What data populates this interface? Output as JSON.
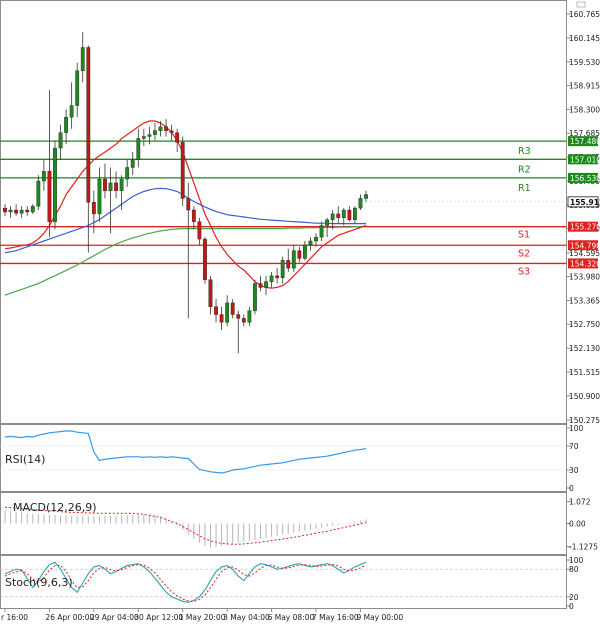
{
  "chart_data": {
    "type": "candlestick",
    "instrument_panel": {
      "price_ticks": [
        "160.765",
        "160.145",
        "159.530",
        "158.915",
        "158.300",
        "157.685",
        "157.065",
        "156.450",
        "155.835",
        "155.220",
        "154.595",
        "153.980",
        "153.365",
        "152.750",
        "152.130",
        "151.515",
        "150.900",
        "150.275"
      ],
      "ylim": [
        150.0,
        161.0
      ],
      "last_price": "155.912",
      "levels": [
        {
          "name": "R3",
          "value": 157.48,
          "label": "157.480",
          "color": "#1b8a1b"
        },
        {
          "name": "R2",
          "value": 157.01,
          "label": "157.010",
          "color": "#1b8a1b"
        },
        {
          "name": "R1",
          "value": 156.53,
          "label": "156.530",
          "color": "#1b8a1b"
        },
        {
          "name": "S1",
          "value": 155.27,
          "label": "155.270",
          "color": "#e02020"
        },
        {
          "name": "S2",
          "value": 154.79,
          "label": "154.790",
          "color": "#e02020"
        },
        {
          "name": "S3",
          "value": 154.32,
          "label": "154.320",
          "color": "#e02020"
        }
      ],
      "candles": [
        {
          "o": 155.75,
          "h": 155.85,
          "l": 155.55,
          "c": 155.65
        },
        {
          "o": 155.65,
          "h": 155.8,
          "l": 155.5,
          "c": 155.7
        },
        {
          "o": 155.7,
          "h": 155.85,
          "l": 155.55,
          "c": 155.62
        },
        {
          "o": 155.62,
          "h": 155.8,
          "l": 155.5,
          "c": 155.7
        },
        {
          "o": 155.7,
          "h": 155.8,
          "l": 155.55,
          "c": 155.65
        },
        {
          "o": 155.65,
          "h": 155.85,
          "l": 155.6,
          "c": 155.8
        },
        {
          "o": 155.8,
          "h": 156.6,
          "l": 155.7,
          "c": 156.45
        },
        {
          "o": 156.45,
          "h": 157.0,
          "l": 156.2,
          "c": 156.7
        },
        {
          "o": 156.7,
          "h": 158.8,
          "l": 155.0,
          "c": 155.4
        },
        {
          "o": 155.4,
          "h": 157.5,
          "l": 155.2,
          "c": 157.3
        },
        {
          "o": 157.3,
          "h": 157.9,
          "l": 157.0,
          "c": 157.7
        },
        {
          "o": 157.7,
          "h": 158.3,
          "l": 157.4,
          "c": 158.1
        },
        {
          "o": 158.1,
          "h": 159.0,
          "l": 157.8,
          "c": 158.4
        },
        {
          "o": 158.4,
          "h": 159.5,
          "l": 158.1,
          "c": 159.3
        },
        {
          "o": 159.3,
          "h": 160.3,
          "l": 159.0,
          "c": 159.9
        },
        {
          "o": 159.9,
          "h": 159.95,
          "l": 154.6,
          "c": 155.9
        },
        {
          "o": 155.9,
          "h": 156.2,
          "l": 155.1,
          "c": 155.6
        },
        {
          "o": 155.6,
          "h": 156.8,
          "l": 155.4,
          "c": 156.5
        },
        {
          "o": 156.5,
          "h": 156.9,
          "l": 156.0,
          "c": 156.2
        },
        {
          "o": 156.2,
          "h": 156.8,
          "l": 155.1,
          "c": 156.4
        },
        {
          "o": 156.4,
          "h": 156.7,
          "l": 156.0,
          "c": 156.2
        },
        {
          "o": 156.2,
          "h": 156.6,
          "l": 155.7,
          "c": 156.5
        },
        {
          "o": 156.5,
          "h": 157.0,
          "l": 156.3,
          "c": 156.8
        },
        {
          "o": 156.8,
          "h": 157.2,
          "l": 156.6,
          "c": 157.0
        },
        {
          "o": 157.0,
          "h": 157.8,
          "l": 156.8,
          "c": 157.55
        },
        {
          "o": 157.55,
          "h": 157.8,
          "l": 157.35,
          "c": 157.6
        },
        {
          "o": 157.6,
          "h": 157.85,
          "l": 157.4,
          "c": 157.65
        },
        {
          "o": 157.65,
          "h": 157.95,
          "l": 157.5,
          "c": 157.75
        },
        {
          "o": 157.75,
          "h": 158.0,
          "l": 157.6,
          "c": 157.85
        },
        {
          "o": 157.85,
          "h": 158.05,
          "l": 157.6,
          "c": 157.75
        },
        {
          "o": 157.75,
          "h": 157.9,
          "l": 157.5,
          "c": 157.7
        },
        {
          "o": 157.7,
          "h": 157.8,
          "l": 157.2,
          "c": 157.45
        },
        {
          "o": 157.45,
          "h": 157.6,
          "l": 155.8,
          "c": 156.0
        },
        {
          "o": 156.0,
          "h": 156.4,
          "l": 152.9,
          "c": 155.7
        },
        {
          "o": 155.7,
          "h": 155.8,
          "l": 155.2,
          "c": 155.4
        },
        {
          "o": 155.4,
          "h": 155.5,
          "l": 154.8,
          "c": 154.95
        },
        {
          "o": 154.95,
          "h": 155.0,
          "l": 153.8,
          "c": 153.9
        },
        {
          "o": 153.9,
          "h": 154.0,
          "l": 153.0,
          "c": 153.2
        },
        {
          "o": 153.2,
          "h": 153.4,
          "l": 152.8,
          "c": 153.0
        },
        {
          "o": 153.0,
          "h": 153.2,
          "l": 152.6,
          "c": 152.8
        },
        {
          "o": 152.8,
          "h": 153.5,
          "l": 152.7,
          "c": 153.3
        },
        {
          "o": 153.3,
          "h": 153.4,
          "l": 152.9,
          "c": 153.0
        },
        {
          "o": 153.0,
          "h": 153.1,
          "l": 152.0,
          "c": 152.9
        },
        {
          "o": 152.9,
          "h": 153.0,
          "l": 152.7,
          "c": 152.8
        },
        {
          "o": 152.8,
          "h": 153.2,
          "l": 152.7,
          "c": 153.1
        },
        {
          "o": 153.1,
          "h": 153.9,
          "l": 153.0,
          "c": 153.8
        },
        {
          "o": 153.8,
          "h": 154.0,
          "l": 153.6,
          "c": 153.7
        },
        {
          "o": 153.7,
          "h": 154.0,
          "l": 153.5,
          "c": 153.85
        },
        {
          "o": 153.85,
          "h": 154.1,
          "l": 153.7,
          "c": 154.0
        },
        {
          "o": 154.0,
          "h": 154.2,
          "l": 153.8,
          "c": 153.95
        },
        {
          "o": 153.95,
          "h": 154.5,
          "l": 153.8,
          "c": 154.4
        },
        {
          "o": 154.4,
          "h": 154.7,
          "l": 154.1,
          "c": 154.2
        },
        {
          "o": 154.2,
          "h": 154.8,
          "l": 154.1,
          "c": 154.65
        },
        {
          "o": 154.65,
          "h": 154.75,
          "l": 154.35,
          "c": 154.45
        },
        {
          "o": 154.45,
          "h": 154.9,
          "l": 154.4,
          "c": 154.8
        },
        {
          "o": 154.8,
          "h": 155.0,
          "l": 154.65,
          "c": 154.9
        },
        {
          "o": 154.9,
          "h": 155.1,
          "l": 154.75,
          "c": 155.0
        },
        {
          "o": 155.0,
          "h": 155.4,
          "l": 154.9,
          "c": 155.3
        },
        {
          "o": 155.3,
          "h": 155.5,
          "l": 155.0,
          "c": 155.45
        },
        {
          "o": 155.45,
          "h": 155.7,
          "l": 155.2,
          "c": 155.6
        },
        {
          "o": 155.6,
          "h": 155.8,
          "l": 155.35,
          "c": 155.5
        },
        {
          "o": 155.5,
          "h": 155.75,
          "l": 155.3,
          "c": 155.7
        },
        {
          "o": 155.7,
          "h": 155.8,
          "l": 155.4,
          "c": 155.45
        },
        {
          "o": 155.45,
          "h": 155.8,
          "l": 155.35,
          "c": 155.75
        },
        {
          "o": 155.75,
          "h": 156.1,
          "l": 155.7,
          "c": 156.0
        },
        {
          "o": 156.0,
          "h": 156.2,
          "l": 155.9,
          "c": 156.1
        }
      ],
      "ma_red": [
        154.7,
        154.72,
        154.75,
        154.78,
        154.8,
        154.85,
        154.95,
        155.1,
        155.3,
        155.55,
        155.8,
        156.1,
        156.3,
        156.5,
        156.7,
        156.85,
        157.0,
        157.1,
        157.2,
        157.3,
        157.4,
        157.55,
        157.65,
        157.75,
        157.85,
        157.95,
        158.0,
        158.0,
        157.95,
        157.85,
        157.7,
        157.5,
        157.2,
        156.8,
        156.4,
        156.0,
        155.6,
        155.3,
        155.0,
        154.75,
        154.55,
        154.4,
        154.25,
        154.15,
        154.0,
        153.85,
        153.75,
        153.7,
        153.68,
        153.7,
        153.75,
        153.85,
        154.0,
        154.15,
        154.3,
        154.45,
        154.6,
        154.75,
        154.85,
        154.95,
        155.05,
        155.1,
        155.15,
        155.2,
        155.25,
        155.3
      ],
      "ma_blue": [
        154.6,
        154.62,
        154.65,
        154.7,
        154.75,
        154.8,
        154.85,
        154.9,
        154.95,
        155.0,
        155.05,
        155.1,
        155.15,
        155.2,
        155.25,
        155.3,
        155.38,
        155.45,
        155.55,
        155.65,
        155.75,
        155.85,
        155.95,
        156.05,
        156.12,
        156.18,
        156.22,
        156.25,
        156.26,
        156.25,
        156.22,
        156.18,
        156.1,
        156.0,
        155.92,
        155.85,
        155.78,
        155.72,
        155.66,
        155.62,
        155.58,
        155.56,
        155.54,
        155.52,
        155.5,
        155.48,
        155.46,
        155.45,
        155.44,
        155.43,
        155.42,
        155.41,
        155.4,
        155.39,
        155.38,
        155.37,
        155.36,
        155.36,
        155.36,
        155.35,
        155.35,
        155.35,
        155.35,
        155.35,
        155.35,
        155.35
      ],
      "ma_green": [
        153.5,
        153.55,
        153.6,
        153.65,
        153.7,
        153.75,
        153.8,
        153.87,
        153.94,
        154.0,
        154.07,
        154.14,
        154.21,
        154.28,
        154.36,
        154.44,
        154.52,
        154.6,
        154.68,
        154.75,
        154.82,
        154.88,
        154.93,
        154.98,
        155.02,
        155.06,
        155.1,
        155.13,
        155.16,
        155.18,
        155.2,
        155.21,
        155.22,
        155.22,
        155.22,
        155.22,
        155.22,
        155.22,
        155.22,
        155.22,
        155.22,
        155.22,
        155.22,
        155.22,
        155.22,
        155.22,
        155.22,
        155.22,
        155.22,
        155.22,
        155.22,
        155.23,
        155.23,
        155.23,
        155.24,
        155.24,
        155.24,
        155.25,
        155.25,
        155.25,
        155.26,
        155.26,
        155.26,
        155.27,
        155.27,
        155.27
      ]
    },
    "rsi_panel": {
      "label": "RSI(14)",
      "ticks": [
        "100",
        "70",
        "30",
        "0"
      ],
      "ylim": [
        0,
        100
      ],
      "values": [
        85,
        86,
        85,
        84,
        86,
        85,
        88,
        90,
        92,
        93,
        94,
        95,
        95,
        93,
        92,
        91,
        60,
        46,
        48,
        49,
        50,
        51,
        52,
        52,
        52,
        51,
        52,
        51,
        52,
        51,
        52,
        51,
        50,
        49,
        40,
        31,
        29,
        27,
        26,
        25,
        27,
        30,
        31,
        32,
        34,
        36,
        38,
        39,
        40,
        41,
        42,
        44,
        46,
        48,
        49,
        50,
        51,
        52,
        53,
        55,
        57,
        59,
        61,
        63,
        64,
        66
      ]
    },
    "macd_panel": {
      "label": "MACD(12,26,9)",
      "ticks": [
        "1.072",
        "0.00",
        "-1.1275"
      ],
      "ylim": [
        -1.4,
        1.35
      ],
      "histogram": [
        0.65,
        0.62,
        0.6,
        0.55,
        0.5,
        0.47,
        0.45,
        0.44,
        0.43,
        0.42,
        0.4,
        0.39,
        0.38,
        0.37,
        0.37,
        0.36,
        0.35,
        0.36,
        0.37,
        0.38,
        0.39,
        0.4,
        0.41,
        0.42,
        0.43,
        0.43,
        0.42,
        0.4,
        0.35,
        0.25,
        0.1,
        -0.1,
        -0.3,
        -0.55,
        -0.75,
        -0.95,
        -1.1,
        -1.2,
        -1.15,
        -1.1,
        -1.05,
        -1.0,
        -0.95,
        -0.9,
        -0.85,
        -0.8,
        -0.75,
        -0.7,
        -0.65,
        -0.6,
        -0.55,
        -0.5,
        -0.45,
        -0.4,
        -0.35,
        -0.3,
        -0.25,
        -0.2,
        -0.15,
        -0.1,
        -0.05,
        0.0,
        0.05,
        0.1,
        0.15,
        0.2
      ],
      "signal": [
        0.8,
        0.78,
        0.75,
        0.72,
        0.7,
        0.68,
        0.66,
        0.64,
        0.62,
        0.6,
        0.58,
        0.56,
        0.55,
        0.54,
        0.53,
        0.52,
        0.51,
        0.5,
        0.5,
        0.5,
        0.5,
        0.5,
        0.5,
        0.5,
        0.48,
        0.45,
        0.4,
        0.35,
        0.3,
        0.2,
        0.1,
        0.0,
        -0.15,
        -0.3,
        -0.45,
        -0.6,
        -0.75,
        -0.85,
        -0.92,
        -0.98,
        -1.0,
        -1.02,
        -1.02,
        -1.0,
        -0.98,
        -0.95,
        -0.92,
        -0.88,
        -0.84,
        -0.8,
        -0.76,
        -0.72,
        -0.68,
        -0.63,
        -0.58,
        -0.53,
        -0.48,
        -0.43,
        -0.38,
        -0.32,
        -0.26,
        -0.2,
        -0.14,
        -0.08,
        -0.02,
        0.05
      ]
    },
    "stoch_panel": {
      "label": "Stoch(9,6,3)",
      "ticks": [
        "100",
        "80",
        "20",
        "0"
      ],
      "ylim": [
        0,
        100
      ],
      "k": [
        70,
        75,
        80,
        78,
        60,
        40,
        55,
        75,
        90,
        95,
        80,
        60,
        40,
        30,
        50,
        70,
        85,
        88,
        80,
        70,
        75,
        82,
        88,
        90,
        92,
        85,
        75,
        60,
        45,
        30,
        20,
        15,
        10,
        8,
        12,
        20,
        35,
        55,
        75,
        85,
        88,
        80,
        65,
        55,
        70,
        85,
        92,
        90,
        85,
        80,
        82,
        86,
        90,
        92,
        88,
        85,
        87,
        90,
        92,
        88,
        80,
        72,
        78,
        85,
        90,
        95
      ],
      "d": [
        65,
        70,
        74,
        77,
        70,
        58,
        52,
        62,
        78,
        88,
        88,
        75,
        55,
        40,
        42,
        55,
        72,
        82,
        84,
        79,
        76,
        79,
        84,
        88,
        90,
        89,
        82,
        72,
        58,
        44,
        31,
        22,
        15,
        11,
        10,
        14,
        24,
        40,
        58,
        75,
        83,
        85,
        78,
        68,
        65,
        72,
        82,
        88,
        89,
        85,
        82,
        83,
        86,
        89,
        90,
        88,
        86,
        87,
        89,
        90,
        87,
        80,
        76,
        78,
        83,
        88
      ]
    },
    "x_labels": [
      "r 16:00",
      "26 Apr 00:00",
      "29 Apr 04:00",
      "30 Apr 12:00",
      "1 May 20:00",
      "3 May 04:00",
      "6 May 08:00",
      "7 May 16:00",
      "9 May 00:00"
    ],
    "x_label_index": [
      0,
      8,
      16,
      24,
      32,
      40,
      48,
      56,
      64
    ]
  }
}
